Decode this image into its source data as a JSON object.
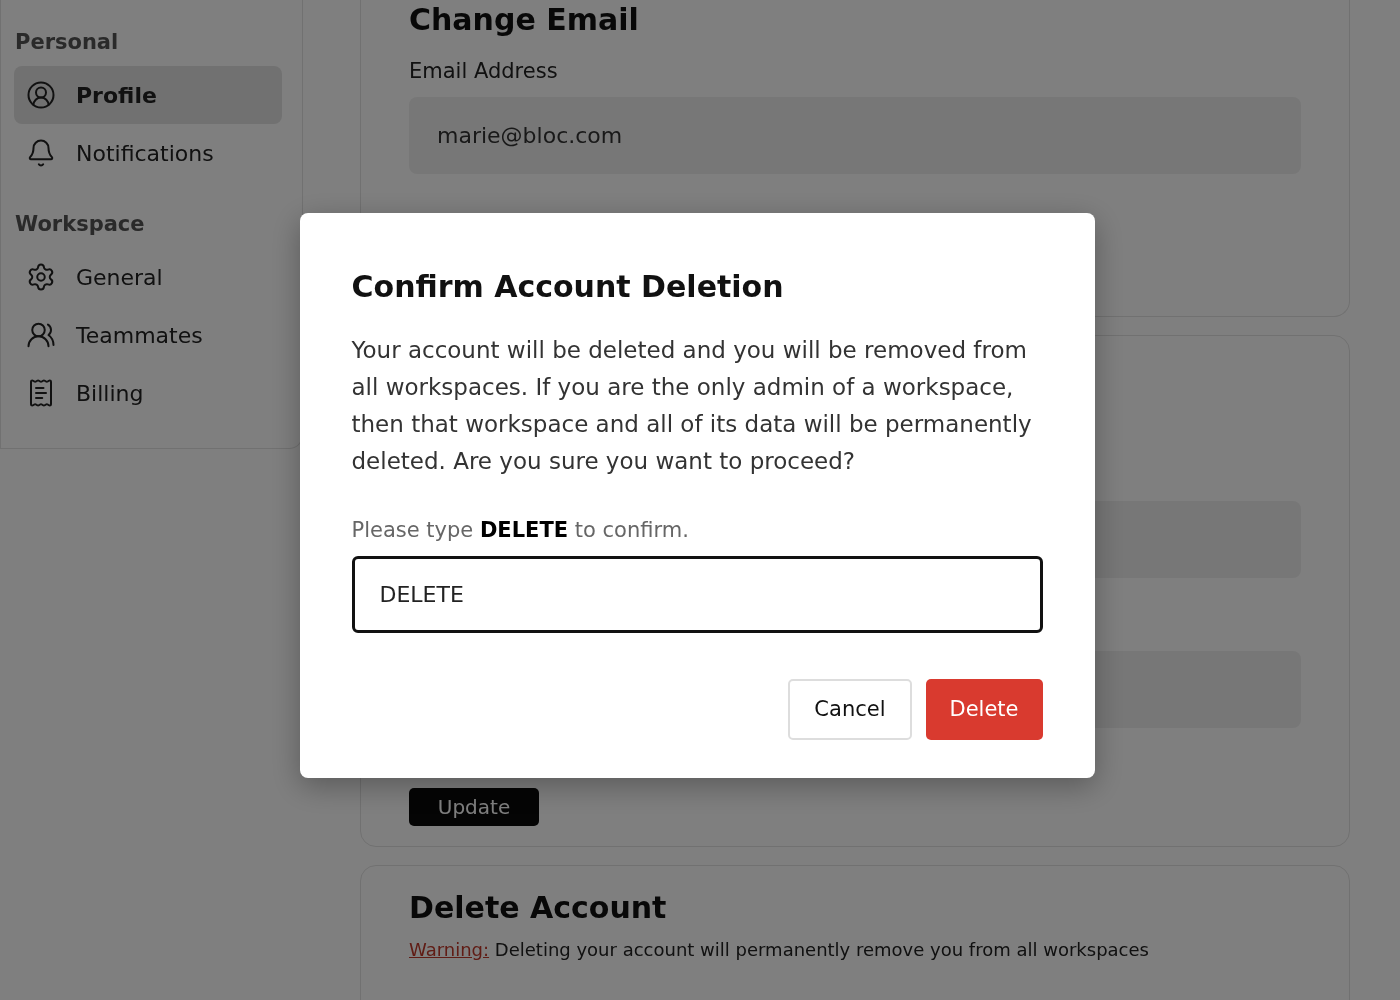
{
  "sidebar": {
    "sections": [
      {
        "title": "Personal",
        "items": [
          {
            "label": "Profile",
            "selected": true
          },
          {
            "label": "Notifications",
            "selected": false
          }
        ]
      },
      {
        "title": "Workspace",
        "items": [
          {
            "label": "General",
            "selected": false
          },
          {
            "label": "Teammates",
            "selected": false
          },
          {
            "label": "Billing",
            "selected": false
          }
        ]
      }
    ]
  },
  "change_email": {
    "title": "Change Email",
    "label": "Email Address",
    "value": "marie@bloc.com"
  },
  "second_card": {
    "button": "Update"
  },
  "delete_account": {
    "title": "Delete Account",
    "warning_label": "Warning:",
    "warning_text": "Deleting your account will permanently remove you from all workspaces"
  },
  "dialog": {
    "title": "Confirm Account Deletion",
    "message": "Your account will be deleted and you will be removed from all workspaces. If you are the only admin of a workspace, then that workspace and all of its data will be permanently deleted. Are you sure you want to proceed?",
    "prompt": "Please type **DELETE** to confirm.",
    "input_value": "DELETE",
    "buttons": [
      {
        "label": "Cancel",
        "kind": "secondary"
      },
      {
        "label": "Delete",
        "kind": "danger"
      }
    ]
  }
}
